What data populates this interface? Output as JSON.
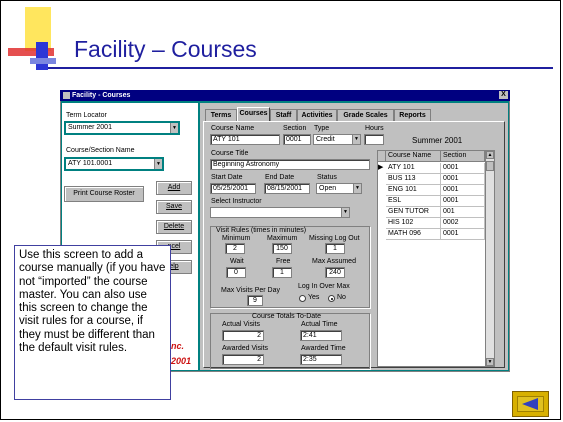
{
  "slide": {
    "title": "Facility – Courses",
    "callout": "Use this screen to add a course manually (if you have not “imported” the course master. You can also use this screen to change the visit rules for a course, if they must be different than the default visit rules.",
    "bg_text_1": "nc.",
    "bg_text_2": "2001"
  },
  "window": {
    "title": "Facility - Courses",
    "close_label": "X"
  },
  "left": {
    "term_locator_label": "Term Locator",
    "term_value": "Summer 2001",
    "course_section_label": "Course/Section Name",
    "course_section_value": "ATY 101.0001",
    "print_roster_label": "Print Course Roster",
    "add_label": "Add",
    "save_label": "Save",
    "delete_label": "Delete",
    "cancel_label": "ncel",
    "help_label": "elp"
  },
  "tabs": [
    "Terms",
    "Courses",
    "Staff",
    "Activities",
    "Grade Scales",
    "Reports"
  ],
  "form": {
    "course_name_label": "Course Name",
    "course_name": "ATY 101",
    "section_label": "Section",
    "section": "0001",
    "type_label": "Type",
    "type": "Credit",
    "hours_label": "Hours",
    "hours": "",
    "term_display": "Summer 2001",
    "course_title_label": "Course Title",
    "course_title": "Beginning Astronomy",
    "start_date_label": "Start Date",
    "start_date": "05/25/2001",
    "end_date_label": "End Date",
    "end_date": "08/15/2001",
    "status_label": "Status",
    "status": "Open",
    "instructor_label": "Select Instructor",
    "instructor": ""
  },
  "visit_rules": {
    "heading": "Visit Rules  (times in minutes)",
    "minimum_label": "Minimum",
    "minimum": "2",
    "maximum_label": "Maximum",
    "maximum": "150",
    "missing_logout_label": "Missing Log Out",
    "missing_logout": "1",
    "wait_label": "Wait",
    "wait": "0",
    "free_label": "Free",
    "free": "1",
    "max_assumed_label": "Max Assumed",
    "max_assumed": "240",
    "max_visits_label": "Max Visits Per Day",
    "max_visits": "9",
    "login_over_max_label": "Log In Over Max",
    "yes_label": "Yes",
    "no_label": "No"
  },
  "totals": {
    "heading": "Course Totals To-Date",
    "actual_visits_label": "Actual Visits",
    "actual_visits": "2",
    "actual_time_label": "Actual Time",
    "actual_time": "2:41",
    "awarded_visits_label": "Awarded Visits",
    "awarded_visits": "2",
    "awarded_time_label": "Awarded Time",
    "awarded_time": "2:35"
  },
  "grid": {
    "headers": [
      "Course Name",
      "Section"
    ],
    "rows": [
      [
        "ATY 101",
        "0001"
      ],
      [
        "BUS 113",
        "0001"
      ],
      [
        "ENG 101",
        "0001"
      ],
      [
        "ESL",
        "0001"
      ],
      [
        "GEN TUTOR",
        "001"
      ],
      [
        "HIS 102",
        "0002"
      ],
      [
        "MATH 096",
        "0001"
      ]
    ],
    "current_row_marker": "▶"
  },
  "colors": {
    "title": "#1f1f9f",
    "window_bg": "#008080",
    "titlebar": "#000080",
    "highlight_border": "#008080",
    "nav_button": "#d8b000",
    "nav_arrow": "#3040c0"
  },
  "icons": {
    "nav": "back-arrow-icon"
  }
}
